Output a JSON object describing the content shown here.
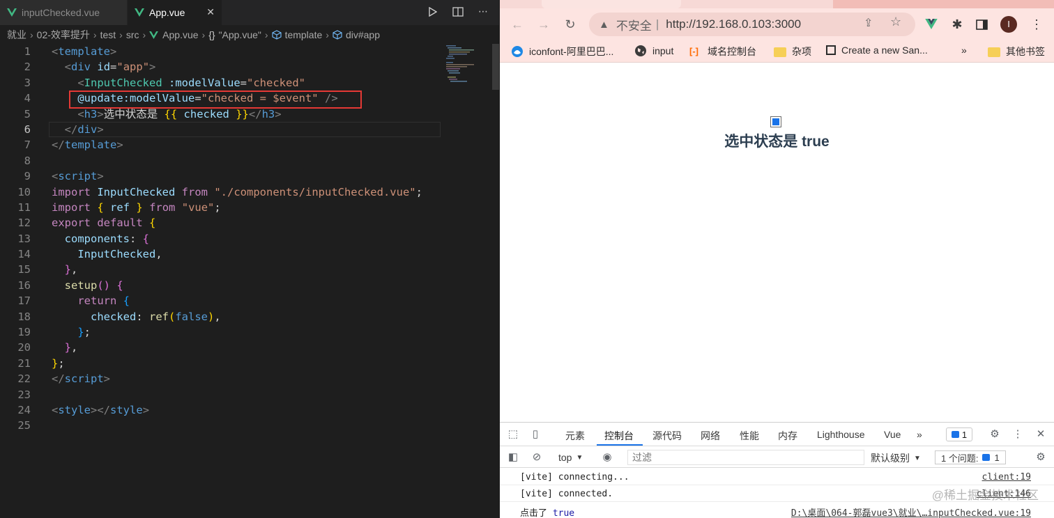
{
  "editor": {
    "tabs": [
      {
        "label": "inputChecked.vue"
      },
      {
        "label": "App.vue",
        "close": "✕"
      }
    ],
    "breadcrumb": [
      "就业",
      "02-效率提升",
      "test",
      "src",
      "App.vue",
      "\"App.vue\"",
      "template",
      "div#app"
    ],
    "line_numbers": [
      "1",
      "2",
      "3",
      "4",
      "5",
      "6",
      "7",
      "8",
      "9",
      "10",
      "11",
      "12",
      "13",
      "14",
      "15",
      "16",
      "17",
      "18",
      "19",
      "20",
      "21",
      "22",
      "23",
      "24",
      "25"
    ],
    "active_line": "6",
    "code": {
      "l1_tag": "template",
      "l2_tag": "div",
      "l2_attr": "id",
      "l2_val": "\"app\"",
      "l3_comp": "InputChecked",
      "l3_attr": ":modelValue",
      "l3_val": "\"checked\"",
      "l4_attr": "@update:modelValue",
      "l4_val": "\"checked = $event\"",
      "l5_tag": "h3",
      "l5_text": "选中状态是 ",
      "l5_var": "checked",
      "l6_tag": "div",
      "l7_tag": "template",
      "l9_tag": "script",
      "l10_kw": "import",
      "l10_name": "InputChecked",
      "l10_from": "from",
      "l10_path": "\"./components/inputChecked.vue\"",
      "l11_kw": "import",
      "l11_name": "ref",
      "l11_from": "from",
      "l11_path": "\"vue\"",
      "l12_kw1": "export",
      "l12_kw2": "default",
      "l13_key": "components",
      "l14_item": "InputChecked",
      "l16_fn": "setup",
      "l17_kw": "return",
      "l18_key": "checked",
      "l18_fn": "ref",
      "l18_val": "false",
      "l22_tag": "script",
      "l24_tag": "style"
    }
  },
  "browser": {
    "address": {
      "insecure_label": "不安全",
      "url": "http://192.168.0.103:3000"
    },
    "avatar_letter": "I",
    "bookmarks": [
      {
        "label": "iconfont-阿里巴巴..."
      },
      {
        "label": "input"
      },
      {
        "label": "域名控制台"
      },
      {
        "label": "杂项"
      },
      {
        "label": "Create a new San..."
      },
      {
        "label": "»"
      },
      {
        "label": "其他书签"
      }
    ],
    "page": {
      "checked": true,
      "heading": "选中状态是 true"
    },
    "devtools": {
      "tabs": [
        "元素",
        "控制台",
        "源代码",
        "网络",
        "性能",
        "内存",
        "Lighthouse",
        "Vue",
        "»"
      ],
      "active_tab": "控制台",
      "issue_count": "1",
      "context": "top",
      "filter_placeholder": "过滤",
      "level": "默认级别",
      "issues_label": "1 个问题:",
      "issues_count": "1",
      "console": [
        {
          "message": "[vite] connecting...",
          "source": "client:19"
        },
        {
          "message": "[vite] connected.",
          "source": "client:146"
        },
        {
          "message": "点击了 ",
          "value": "true",
          "source": "D:\\桌面\\064-郭磊vue3\\就业\\…inputChecked.vue:19"
        }
      ]
    },
    "watermark": "@稀土掘金技术社区"
  },
  "colors": {
    "editor_bg": "#1e1e1e",
    "vue_green": "#41b883",
    "highlight_box": "#e53935",
    "chrome_pink": "#fde4e1",
    "devtools_blue": "#1a73e8"
  }
}
